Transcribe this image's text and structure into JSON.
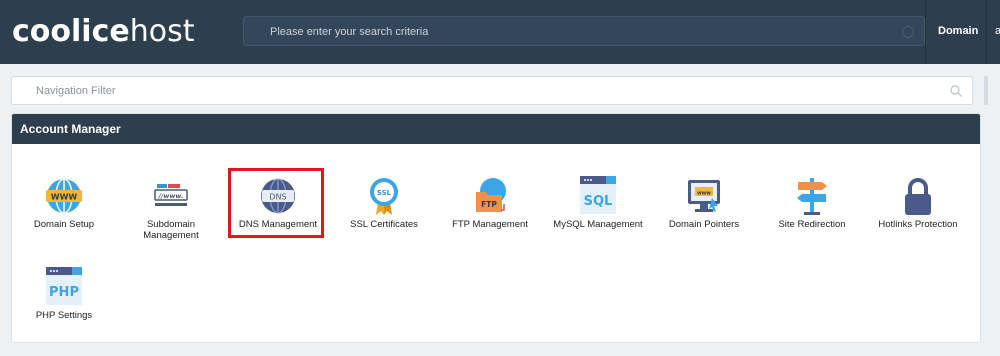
{
  "header": {
    "logo_bold": "coolice",
    "logo_light": "host",
    "search_placeholder": "Please enter your search criteria",
    "domain_label": "Domain",
    "domain_value": "a"
  },
  "nav_filter": {
    "placeholder": "Navigation Filter"
  },
  "panel": {
    "title": "Account Manager"
  },
  "items": [
    {
      "label": "Domain Setup",
      "icon": "globe-www-icon"
    },
    {
      "label": "Subdomain Management",
      "icon": "subdomain-icon"
    },
    {
      "label": "DNS Management",
      "icon": "dns-globe-icon"
    },
    {
      "label": "SSL Certificates",
      "icon": "ssl-badge-icon"
    },
    {
      "label": "FTP Management",
      "icon": "ftp-folder-icon"
    },
    {
      "label": "MySQL Management",
      "icon": "sql-window-icon"
    },
    {
      "label": "Domain Pointers",
      "icon": "monitor-www-icon"
    },
    {
      "label": "Site Redirection",
      "icon": "signpost-icon"
    },
    {
      "label": "Hotlinks Protection",
      "icon": "padlock-icon"
    },
    {
      "label": "PHP Settings",
      "icon": "php-window-icon"
    }
  ],
  "colors": {
    "topbar": "#2d3e4f",
    "highlight": "#e0151e",
    "accent_blue": "#3b8fd6"
  }
}
